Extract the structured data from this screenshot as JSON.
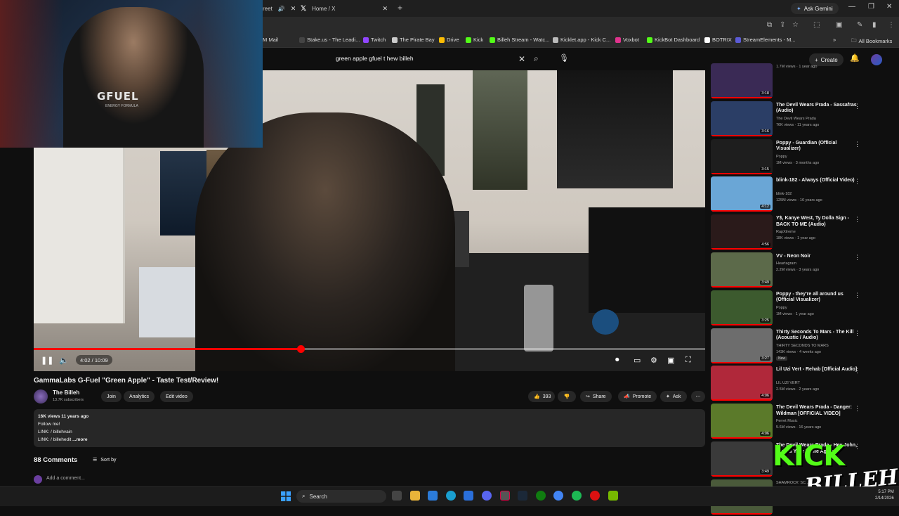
{
  "browser": {
    "partial_tab_label": "reet",
    "active_tab_label": "Home / X",
    "new_tab_symbol": "+",
    "ask_gemini_label": "Ask Gemini",
    "bookmarks": [
      {
        "label": "M Mail",
        "color": "#d93025"
      },
      {
        "label": "Stake.us - The Leadi...",
        "color": "#2c2f36"
      },
      {
        "label": "Twitch",
        "color": "#9146ff"
      },
      {
        "label": "The Pirate Bay",
        "color": "#cccccc"
      },
      {
        "label": "Drive",
        "color": "#fbbc04"
      },
      {
        "label": "Kick",
        "color": "#53fc18"
      },
      {
        "label": "Billeh Stream - Watc...",
        "color": "#53fc18"
      },
      {
        "label": "Kicklet.app - Kick C...",
        "color": "#bbbbbb"
      },
      {
        "label": "Voxbot",
        "color": "#e0338d"
      },
      {
        "label": "KickBot Dashboard",
        "color": "#53fc18"
      },
      {
        "label": "BOTRIX",
        "color": "#ffffff"
      },
      {
        "label": "StreamElements - M...",
        "color": "#5b5bd6"
      }
    ],
    "all_bookmarks_label": "All Bookmarks"
  },
  "youtube": {
    "search_query": "green apple gfuel t hew billeh",
    "create_label": "Create",
    "video": {
      "title": "GammaLabs G-Fuel \"Green Apple\" - Taste Test/Review!",
      "current_time": "4:02",
      "duration": "10:09",
      "time_display": "4:02 / 10:09",
      "progress_fraction": 0.397
    },
    "channel": {
      "name": "The Billeh",
      "subscribers": "13.7K subscribers",
      "join_label": "Join",
      "analytics_label": "Analytics",
      "edit_label": "Edit video"
    },
    "actions": {
      "likes": "393",
      "share_label": "Share",
      "promote_label": "Promote",
      "ask_label": "Ask"
    },
    "description": {
      "stats": "16K views  11 years ago",
      "line1": "Follow me!",
      "line2": "LINK:  / billehvain",
      "line3": "LINK:  / billehedit",
      "more_label": "...more"
    },
    "comments": {
      "count_label": "88 Comments",
      "sort_label": "Sort by",
      "add_placeholder": "Add a comment..."
    }
  },
  "webcam_overlay": {
    "hoodie_text": "GFUEL",
    "hoodie_sub": "ENERGY FORMULA"
  },
  "sidebar": {
    "items": [
      {
        "title": "",
        "channel": "",
        "meta": "1.7M views · 1 year ago",
        "duration": "3:18",
        "thumb": "#3a2a55"
      },
      {
        "title": "The Devil Wears Prada - Sassafras (Audio)",
        "channel": "The Devil Wears Prada",
        "meta": "76K views · 11 years ago",
        "duration": "3:16",
        "thumb": "#2b3e66"
      },
      {
        "title": "Poppy - Guardian (Official Visualizer)",
        "channel": "Poppy",
        "meta": "1M views · 3 months ago",
        "duration": "3:15",
        "thumb": "#1e1e1e"
      },
      {
        "title": "blink-182 - Always (Official Video)",
        "channel": "blink-182",
        "meta": "125M views · 16 years ago",
        "duration": "4:12",
        "thumb": "#6aa6d6"
      },
      {
        "title": "Y$, Kanye West, Ty Dolla Sign - BACK TO ME (Audio)",
        "channel": "RapXtreme",
        "meta": "18K views · 1 year ago",
        "duration": "4:56",
        "thumb": "#2a1a1a"
      },
      {
        "title": "VV - Neon Noir",
        "channel": "Heartagram",
        "meta": "2.2M views · 3 years ago",
        "duration": "3:49",
        "thumb": "#5c6a4a"
      },
      {
        "title": "Poppy - they're all around us (Official Visualizer)",
        "channel": "Poppy",
        "meta": "1M views · 1 year ago",
        "duration": "3:25",
        "thumb": "#3c5a2e"
      },
      {
        "title": "Thirty Seconds To Mars - The Kill (Acoustic / Audio)",
        "channel": "THIRTY SECONDS TO MARS",
        "meta": "143K views · 4 weeks ago",
        "duration": "3:27",
        "thumb": "#6d6d6d",
        "badge": "New"
      },
      {
        "title": "Lil Uzi Vert - Rehab [Official Audio]",
        "channel": "LIL UZI VERT",
        "meta": "2.5M views · 2 years ago",
        "duration": "4:06",
        "thumb": "#b0283a"
      },
      {
        "title": "The Devil Wears Prada - Danger: Wildman [OFFICIAL VIDEO]",
        "channel": "Ferret Music",
        "meta": "5.6M views · 16 years ago",
        "duration": "4:06",
        "thumb": "#5b7a2a"
      },
      {
        "title": "The Devil Wears Prada - Hey John, What's Your Name Again",
        "channel": "",
        "meta": "",
        "duration": "3:49",
        "thumb": "#3a3a3a"
      },
      {
        "title": "",
        "channel": "SHAMROCK' SC...",
        "meta": "26 Billeh",
        "duration": "",
        "thumb": "#4a5a3a"
      }
    ]
  },
  "overlay_logo": {
    "word1": "KICK",
    "word2": "BILLEH"
  },
  "taskbar": {
    "search_label": "Search",
    "clock_time": "5:17 PM",
    "clock_date": "2/14/2026"
  }
}
